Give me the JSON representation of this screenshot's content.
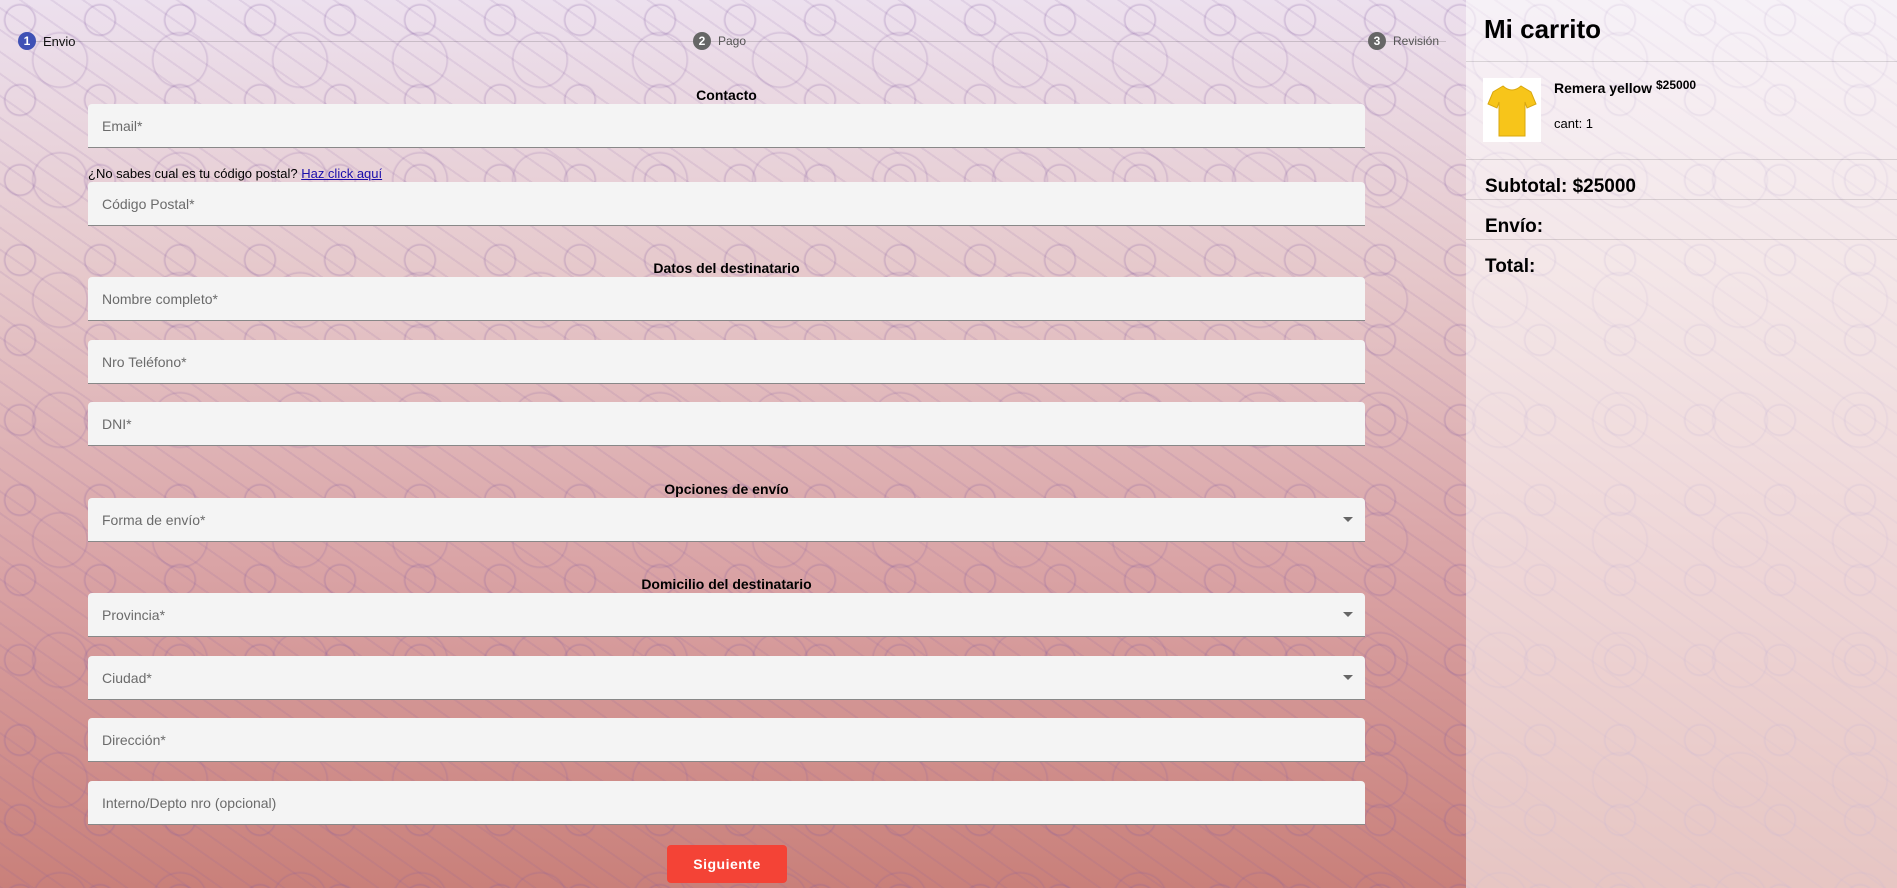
{
  "stepper": {
    "steps": [
      {
        "number": "1",
        "label": "Envio"
      },
      {
        "number": "2",
        "label": "Pago"
      },
      {
        "number": "3",
        "label": "Revisión"
      }
    ]
  },
  "form": {
    "contact_title": "Contacto",
    "email_placeholder": "Email*",
    "postal_hint": "¿No sabes cual es tu código postal?",
    "postal_link": "Haz click aquí",
    "postal_placeholder": "Código Postal*",
    "recipient_title": "Datos del destinatario",
    "name_placeholder": "Nombre completo*",
    "phone_placeholder": "Nro Teléfono*",
    "dni_placeholder": "DNI*",
    "shipping_title": "Opciones de envío",
    "shipping_method_placeholder": "Forma de envío*",
    "address_title": "Domicilio del destinatario",
    "province_placeholder": "Provincia*",
    "city_placeholder": "Ciudad*",
    "street_placeholder": "Dirección*",
    "apt_placeholder": "Interno/Depto nro (opcional)",
    "next_label": "Siguiente"
  },
  "cart": {
    "title": "Mi carrito",
    "items": [
      {
        "name": "Remera yellow",
        "price": "$25000",
        "qty": "cant: 1"
      }
    ],
    "subtotal": "Subtotal: $25000",
    "shipping": "Envío:",
    "total": "Total:"
  },
  "colors": {
    "accent": "#3f51b5",
    "button": "#f44336",
    "product": "#f7c51a"
  }
}
